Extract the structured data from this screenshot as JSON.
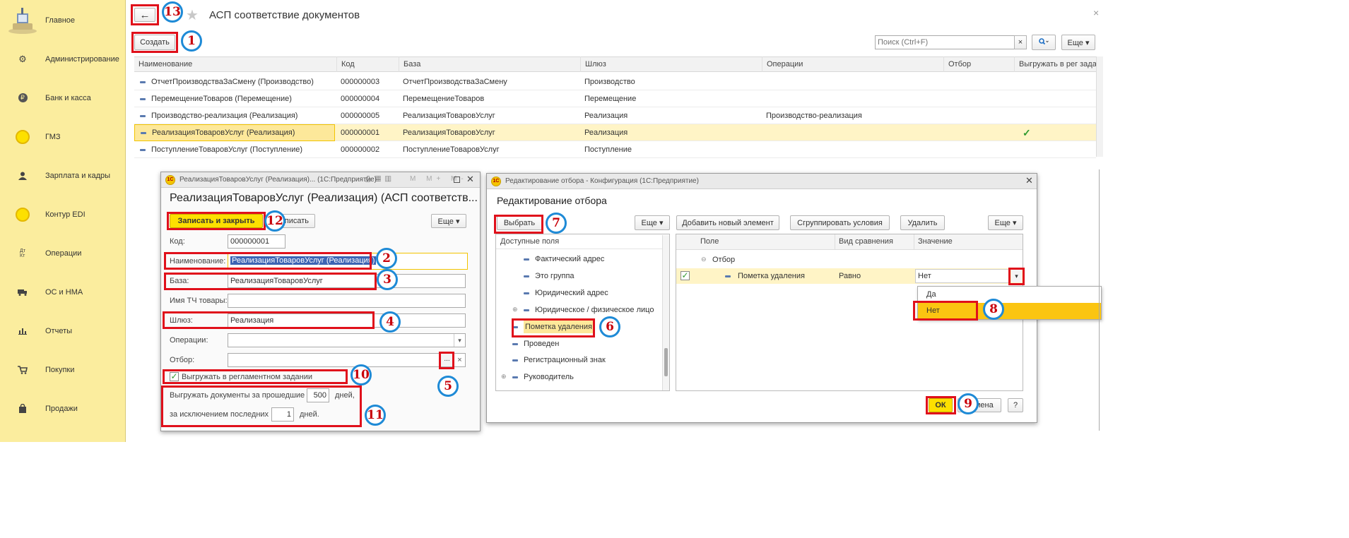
{
  "sidebar": {
    "items": [
      {
        "label": "Главное",
        "icon": "home-desk-icon"
      },
      {
        "label": "Администрирование",
        "icon": "gear-icon"
      },
      {
        "label": "Банк и касса",
        "icon": "ruble-coin-icon"
      },
      {
        "label": "ГМЗ",
        "icon": "yellow-circle-icon"
      },
      {
        "label": "Зарплата и кадры",
        "icon": "person-icon"
      },
      {
        "label": "Контур EDI",
        "icon": "yellow-circle-icon"
      },
      {
        "label": "Операции",
        "icon": "debit-credit-icon"
      },
      {
        "label": "ОС и НМА",
        "icon": "truck-icon"
      },
      {
        "label": "Отчеты",
        "icon": "bar-chart-icon"
      },
      {
        "label": "Покупки",
        "icon": "cart-icon"
      },
      {
        "label": "Продажи",
        "icon": "bag-icon"
      }
    ]
  },
  "header": {
    "title": "АСП соответствие документов",
    "back_glyph": "←",
    "star_glyph": "★",
    "close_glyph": "×"
  },
  "toolbar": {
    "create_label": "Создать",
    "search_placeholder": "Поиск (Ctrl+F)",
    "clear_glyph": "×",
    "more_label": "Еще ▾"
  },
  "grid": {
    "columns": [
      "Наименование",
      "Код",
      "База",
      "Шлюз",
      "Операции",
      "Отбор",
      "Выгружать в рег задан"
    ],
    "rows": [
      {
        "name": "ОтчетПроизводстваЗаСмену (Производство)",
        "code": "000000003",
        "base": "ОтчетПроизводстваЗаСмену",
        "gateway": "Производство",
        "ops": "",
        "filter": "",
        "export": ""
      },
      {
        "name": "ПеремещениеТоваров (Перемещение)",
        "code": "000000004",
        "base": "ПеремещениеТоваров",
        "gateway": "Перемещение",
        "ops": "",
        "filter": "",
        "export": ""
      },
      {
        "name": "Производство-реализация (Реализация)",
        "code": "000000005",
        "base": "РеализацияТоваровУслуг",
        "gateway": "Реализация",
        "ops": "Производство-реализация",
        "filter": "",
        "export": ""
      },
      {
        "name": "РеализацияТоваровУслуг (Реализация)",
        "code": "000000001",
        "base": "РеализацияТоваровУслуг",
        "gateway": "Реализация",
        "ops": "",
        "filter": "",
        "export": "✓"
      },
      {
        "name": "ПоступлениеТоваровУслуг (Поступление)",
        "code": "000000002",
        "base": "ПоступлениеТоваровУслуг",
        "gateway": "Поступление",
        "ops": "",
        "filter": "",
        "export": ""
      }
    ]
  },
  "form": {
    "titlebar": "РеализацияТоваровУслуг (Реализация)... (1С:Предприятие)",
    "title": "РеализацияТоваровУслуг (Реализация) (АСП соответств...",
    "save_close_label": "Записать и закрыть",
    "save_label": "Записать",
    "more_label": "Еще ▾",
    "code_label": "Код:",
    "code_value": "000000001",
    "name_label": "Наименование:",
    "name_value": "РеализацияТоваровУслуг (Реализация)",
    "base_label": "База:",
    "base_value": "РеализацияТоваровУслуг",
    "tch_label": "Имя ТЧ товары:",
    "tch_value": "",
    "gateway_label": "Шлюз:",
    "gateway_value": "Реализация",
    "ops_label": "Операции:",
    "ops_value": "",
    "filter_label": "Отбор:",
    "filter_value": "",
    "export_label": "Выгружать в регламентном задании",
    "export_checked": true,
    "days_prefix": "Выгружать документы за прошедшие",
    "days_value": "500",
    "days_suffix": "дней,",
    "except_prefix": "за исключением последних",
    "except_value": "1",
    "except_suffix": "дней."
  },
  "filter_dialog": {
    "titlebar": "Редактирование отбора - Конфигурация  (1С:Предприятие)",
    "title": "Редактирование отбора",
    "choose_label": "Выбрать",
    "more_label": "Еще ▾",
    "add_label": "Добавить новый элемент",
    "group_label": "Сгруппировать условия",
    "delete_label": "Удалить",
    "more2_label": "Еще ▾",
    "available_header": "Доступные поля",
    "fields": [
      {
        "label": "Фактический адрес",
        "expander": ""
      },
      {
        "label": "Это группа",
        "expander": ""
      },
      {
        "label": "Юридический адрес",
        "expander": ""
      },
      {
        "label": "Юридическое / физическое лицо",
        "expander": "⊕"
      },
      {
        "label": "Пометка удаления",
        "expander": ""
      },
      {
        "label": "Проведен",
        "expander": ""
      },
      {
        "label": "Регистрационный знак",
        "expander": ""
      },
      {
        "label": "Руководитель",
        "expander": "⊕"
      }
    ],
    "columns": [
      "Поле",
      "Вид сравнения",
      "Значение"
    ],
    "group_row": "Отбор",
    "condition": {
      "field": "Пометка удаления",
      "comparison": "Равно",
      "value": "Нет"
    },
    "dropdown_options": [
      "Да",
      "Нет"
    ],
    "ok_label": "ОК",
    "cancel_label": "Отмена",
    "help_label": "?"
  },
  "annotations": [
    "13",
    "1",
    "12",
    "2",
    "3",
    "4",
    "10",
    "11",
    "5",
    "6",
    "7",
    "8",
    "9"
  ],
  "colors": {
    "sidebar": "#fbed9e",
    "highlight_row": "#fff4c6",
    "accent_yellow": "#fde000",
    "annotation_red": "#e0101b",
    "annotation_blue": "#1e8ad6"
  }
}
